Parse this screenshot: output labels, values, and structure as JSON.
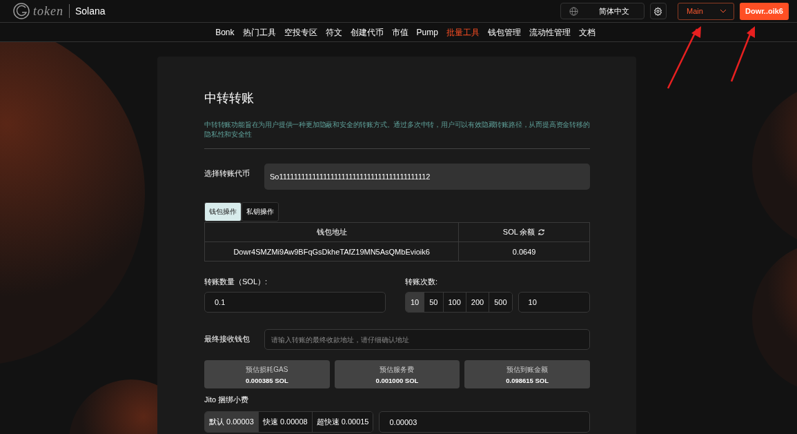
{
  "header": {
    "logo_text": "token",
    "network": "Solana",
    "language": "简体中文",
    "cluster": "Main",
    "wallet": "Dowr..oik6"
  },
  "nav": [
    {
      "label": "Bonk",
      "selected": false
    },
    {
      "label": "热门工具",
      "selected": false
    },
    {
      "label": "空投专区",
      "selected": false
    },
    {
      "label": "符文",
      "selected": false
    },
    {
      "label": "创建代币",
      "selected": false
    },
    {
      "label": "市值",
      "selected": false
    },
    {
      "label": "Pump",
      "selected": false
    },
    {
      "label": "批量工具",
      "selected": true
    },
    {
      "label": "钱包管理",
      "selected": false
    },
    {
      "label": "流动性管理",
      "selected": false
    },
    {
      "label": "文档",
      "selected": false
    }
  ],
  "page": {
    "title": "中转转账",
    "description": "中转转账功能旨在为用户提供一种更加隐蔽和安全的转账方式。通过多次中转，用户可以有效隐藏转账路径，从而提高资金转移的隐私性和安全性"
  },
  "token": {
    "label": "选择转账代币",
    "value": "So11111111111111111111111111111111111111112"
  },
  "mode_tabs": [
    {
      "label": "钱包操作",
      "selected": true
    },
    {
      "label": "私钥操作",
      "selected": false
    }
  ],
  "wallet_table": {
    "columns": [
      "钱包地址",
      "SOL 余额"
    ],
    "rows": [
      [
        "Dowr4SMZMi9Aw9BFqGsDkheTAfZ19MN5AsQMbEvioik6",
        "0.0649"
      ]
    ]
  },
  "amount": {
    "label": "转账数量（SOL）:",
    "value": "0.1"
  },
  "count": {
    "label": "转账次数:",
    "options": [
      {
        "label": "10",
        "selected": true
      },
      {
        "label": "50",
        "selected": false
      },
      {
        "label": "100",
        "selected": false
      },
      {
        "label": "200",
        "selected": false
      },
      {
        "label": "500",
        "selected": false
      }
    ],
    "value": "10"
  },
  "receiver": {
    "label": "最终接收钱包",
    "placeholder": "请输入转账的最终收款地址，请仔细确认地址"
  },
  "estimates": [
    {
      "label": "预估损耗GAS",
      "value": "0.000385 SOL"
    },
    {
      "label": "预估服务费",
      "value": "0.001000 SOL"
    },
    {
      "label": "预估到账金额",
      "value": "0.098615 SOL"
    }
  ],
  "jito": {
    "label": "Jito 捆绑小费",
    "options": [
      {
        "name": "默认",
        "value": "0.00003",
        "selected": true
      },
      {
        "name": "快速",
        "value": "0.00008",
        "selected": false
      },
      {
        "name": "超快速",
        "value": "0.00015",
        "selected": false
      }
    ],
    "value": "0.00003"
  }
}
